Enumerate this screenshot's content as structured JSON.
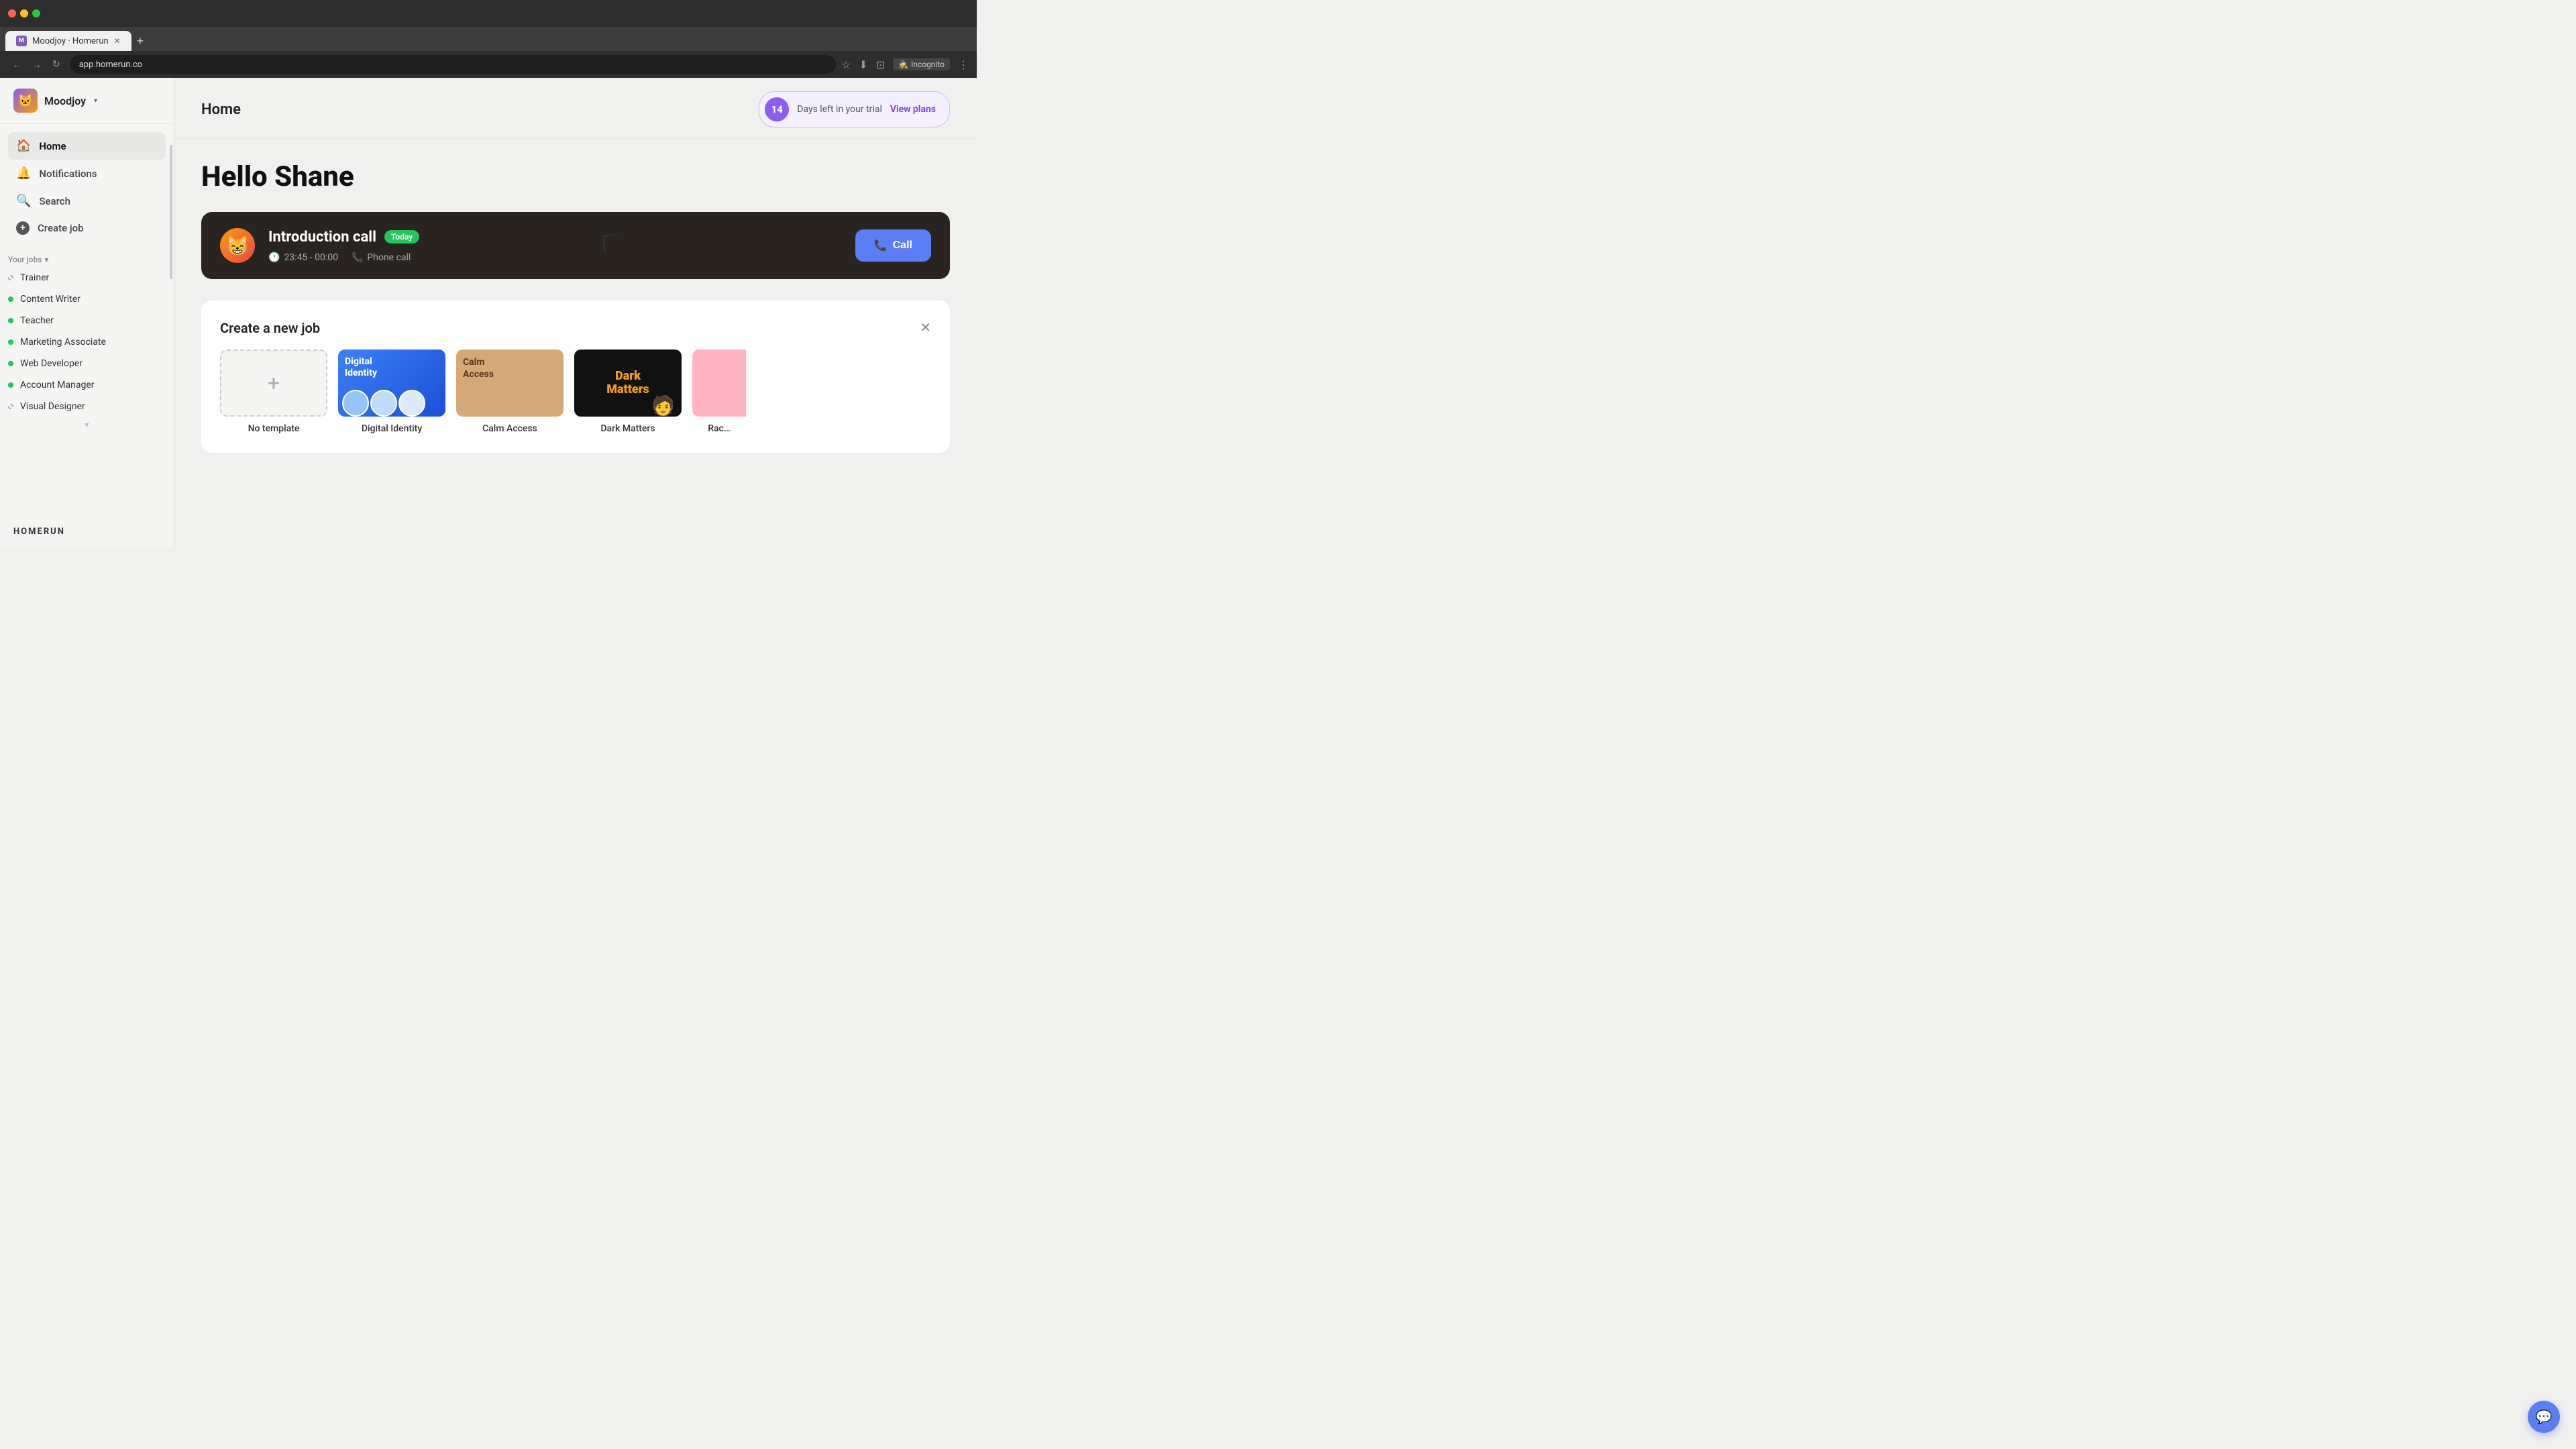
{
  "browser": {
    "url": "app.homerun.co",
    "tab_label": "Moodjoy · Homerun",
    "incognito_label": "Incognito"
  },
  "header": {
    "page_title": "Home",
    "trial_days": "14",
    "trial_text": "Days left in your trial",
    "view_plans_label": "View plans"
  },
  "sidebar": {
    "company_name": "Moodjoy",
    "nav_items": [
      {
        "label": "Home",
        "icon": "🏠",
        "active": true
      },
      {
        "label": "Notifications",
        "icon": "🔔",
        "active": false
      },
      {
        "label": "Search",
        "icon": "🔍",
        "active": false
      },
      {
        "label": "Create job",
        "icon": "+",
        "active": false
      }
    ],
    "your_jobs_label": "Your jobs",
    "jobs": [
      {
        "label": "Trainer",
        "dot_type": "empty"
      },
      {
        "label": "Content Writer",
        "dot_type": "green"
      },
      {
        "label": "Teacher",
        "dot_type": "green"
      },
      {
        "label": "Marketing Associate",
        "dot_type": "green"
      },
      {
        "label": "Web Developer",
        "dot_type": "green"
      },
      {
        "label": "Account Manager",
        "dot_type": "green"
      },
      {
        "label": "Visual Designer",
        "dot_type": "empty"
      }
    ],
    "logo_label": "HOMERUN"
  },
  "main": {
    "greeting": "Hello Shane",
    "interview_card": {
      "title": "Introduction call",
      "badge": "Today",
      "time": "23:45 - 00:00",
      "type": "Phone call",
      "call_button_label": "Call"
    },
    "create_job": {
      "title": "Create a new job",
      "templates": [
        {
          "label": "No template",
          "type": "blank"
        },
        {
          "label": "Digital Identity",
          "type": "digital-identity"
        },
        {
          "label": "Calm Access",
          "type": "calm-access"
        },
        {
          "label": "Dark Matters",
          "type": "dark-matters"
        },
        {
          "label": "Race",
          "type": "race"
        }
      ]
    }
  },
  "chat_button_icon": "💬"
}
